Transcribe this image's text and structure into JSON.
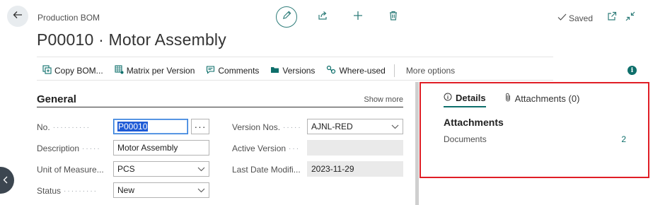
{
  "header": {
    "breadcrumb": "Production BOM",
    "title": "P00010 · Motor Assembly",
    "saved_label": "Saved"
  },
  "icons": {
    "back": "back-arrow-icon",
    "edit": "pencil-icon",
    "share": "share-icon",
    "new": "plus-icon",
    "delete": "trash-icon",
    "saved": "check-icon",
    "open_new_window": "open-in-new-window-icon",
    "collapse": "collapse-icon"
  },
  "actions": {
    "items": [
      {
        "label": "Copy BOM...",
        "icon": "copy-bom-icon"
      },
      {
        "label": "Matrix per Version",
        "icon": "matrix-icon"
      },
      {
        "label": "Comments",
        "icon": "comments-icon"
      },
      {
        "label": "Versions",
        "icon": "versions-icon"
      },
      {
        "label": "Where-used",
        "icon": "where-used-icon"
      }
    ],
    "more_label": "More options"
  },
  "general": {
    "title": "General",
    "show_more": "Show more",
    "fields": {
      "no": {
        "label": "No.",
        "value": "P00010"
      },
      "description": {
        "label": "Description",
        "value": "Motor Assembly"
      },
      "unit": {
        "label": "Unit of Measure...",
        "value": "PCS"
      },
      "status": {
        "label": "Status",
        "value": "New"
      },
      "version_nos": {
        "label": "Version Nos.",
        "value": "AJNL-RED"
      },
      "active_version": {
        "label": "Active Version",
        "value": ""
      },
      "last_date": {
        "label": "Last Date Modifi...",
        "value": "2023-11-29"
      }
    }
  },
  "factbox": {
    "tabs": [
      {
        "label": "Details",
        "icon": "info-icon",
        "active": true
      },
      {
        "label": "Attachments (0)",
        "icon": "paperclip-icon",
        "active": false
      }
    ],
    "title": "Attachments",
    "rows": [
      {
        "label": "Documents",
        "value": "2"
      }
    ]
  },
  "colors": {
    "accent": "#0e6f6b",
    "highlight_border": "#e01e26",
    "selection": "#1f5bd6"
  }
}
